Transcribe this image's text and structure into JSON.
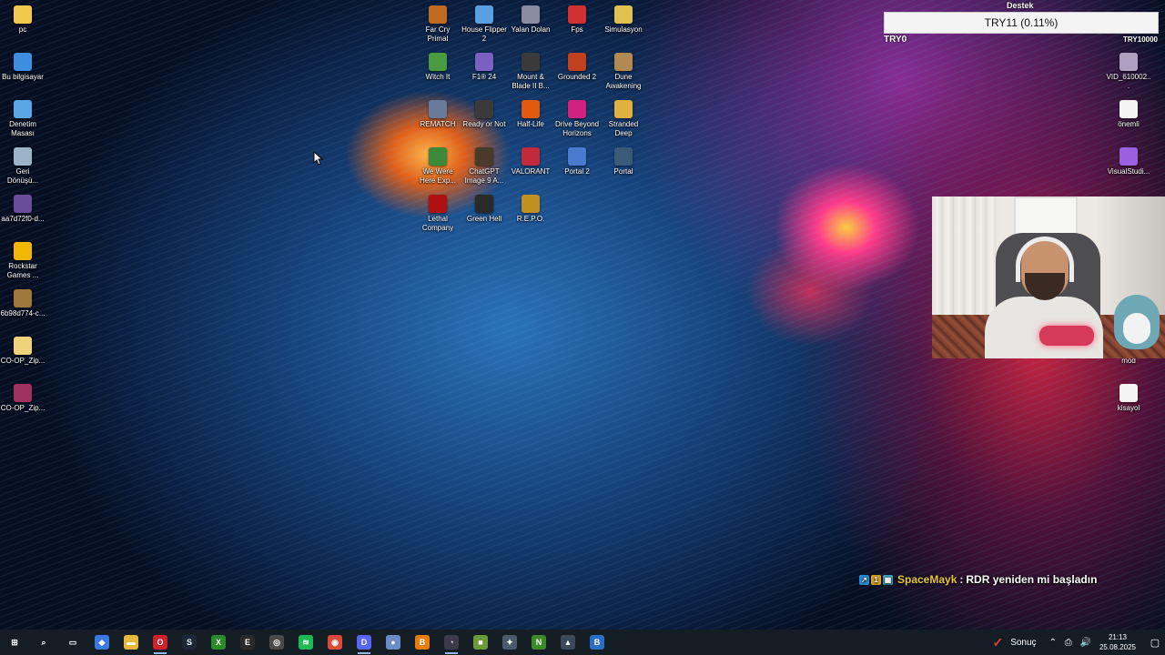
{
  "desktop": {
    "left_icons": [
      {
        "label": "pc",
        "icon": "folder-icon",
        "color": "#f2c94c"
      },
      {
        "label": "Bu bilgisayar",
        "icon": "computer-icon",
        "color": "#3d8ee0"
      },
      {
        "label": "Denetim Masası",
        "icon": "control-panel-icon",
        "color": "#5aa6e6"
      },
      {
        "label": "Geri Dönüşü...",
        "icon": "recycle-bin-icon",
        "color": "#9bb4c8"
      },
      {
        "label": "aa7d72f0-d...",
        "icon": "image-file-icon",
        "color": "#6b4c9a"
      },
      {
        "label": "Rockstar Games ...",
        "icon": "rockstar-icon",
        "color": "#f2b705"
      },
      {
        "label": "6b98d774-c...",
        "icon": "image-file-icon",
        "color": "#a0783c"
      },
      {
        "label": "CO-OP_Zip...",
        "icon": "zip-folder-icon",
        "color": "#f0d27a"
      },
      {
        "label": "CO-OP_Zip...",
        "icon": "winrar-icon",
        "color": "#a03060"
      }
    ],
    "game_icons": [
      [
        {
          "label": "Far Cry Primal",
          "icon": "far-cry-primal-icon",
          "color": "#c06a20"
        },
        {
          "label": "House Flipper 2",
          "icon": "house-flipper-icon",
          "color": "#5aa0e0"
        },
        {
          "label": "Yalan Dolan",
          "icon": "yalan-dolan-icon",
          "color": "#8a8aa0"
        },
        {
          "label": "Fps",
          "icon": "fps-icon",
          "color": "#d03030"
        },
        {
          "label": "Simulasyon",
          "icon": "folder-icon",
          "color": "#e0c050"
        }
      ],
      [
        {
          "label": "Witch It",
          "icon": "witch-it-icon",
          "color": "#4a9a40"
        },
        {
          "label": "F1® 24",
          "icon": "f1-icon",
          "color": "#7a60c0"
        },
        {
          "label": "Mount & Blade II B...",
          "icon": "mount-blade-icon",
          "color": "#3a3a3a"
        },
        {
          "label": "Grounded 2",
          "icon": "grounded-icon",
          "color": "#c04020"
        },
        {
          "label": "Dune Awakening",
          "icon": "dune-icon",
          "color": "#b08a50"
        }
      ],
      [
        {
          "label": "REMATCH",
          "icon": "rematch-icon",
          "color": "#6a7a9a"
        },
        {
          "label": "Ready or Not",
          "icon": "ready-or-not-icon",
          "color": "#3a3a3a"
        },
        {
          "label": "Half-Life",
          "icon": "half-life-icon",
          "color": "#e05a10"
        },
        {
          "label": "Drive Beyond Horizons",
          "icon": "drive-beyond-icon",
          "color": "#d02080"
        },
        {
          "label": "Stranded Deep",
          "icon": "stranded-deep-icon",
          "color": "#e0b040"
        }
      ],
      [
        {
          "label": "We Were Here Exp...",
          "icon": "we-were-here-icon",
          "color": "#3a8a3a"
        },
        {
          "label": "ChatGPT Image 9 A...",
          "icon": "image-file-icon",
          "color": "#4a3a2a"
        },
        {
          "label": "VALORANT",
          "icon": "valorant-icon",
          "color": "#c02a3a"
        },
        {
          "label": "Portal 2",
          "icon": "portal2-icon",
          "color": "#4a7ad0"
        },
        {
          "label": "Portal",
          "icon": "portal-icon",
          "color": "#3a5a7a"
        }
      ],
      [
        {
          "label": "Lethal Company",
          "icon": "lethal-company-icon",
          "color": "#b01010"
        },
        {
          "label": "Green Hell",
          "icon": "green-hell-icon",
          "color": "#2a2a2a"
        },
        {
          "label": "R.E.P.O.",
          "icon": "repo-icon",
          "color": "#c09020"
        }
      ]
    ],
    "right_icons": [
      {
        "label": "VID_610002...",
        "icon": "video-file-icon",
        "color": "#b0a0c0"
      },
      {
        "label": "önemli",
        "icon": "text-file-icon",
        "color": "#f4f4f4"
      },
      {
        "label": "VisualStudi...",
        "icon": "visual-studio-icon",
        "color": "#9a60e0"
      },
      {
        "label": "mod",
        "icon": "text-file-icon",
        "color": "#f4f4f4"
      },
      {
        "label": "kisayol",
        "icon": "text-file-icon",
        "color": "#f4f4f4"
      }
    ]
  },
  "donation": {
    "title": "Destek",
    "progress_text": "TRY11 (0.11%)",
    "progress_fraction": 0.0011,
    "min_label": "TRY0",
    "max_label": "TRY10000"
  },
  "chat": {
    "username": "SpaceMayk",
    "separator": ":",
    "message": "RDR yeniden mi başladın",
    "badge_1": "1",
    "username_color": "#e8c53a"
  },
  "taskbar": {
    "items": [
      {
        "name": "start-icon",
        "glyph": "⊞",
        "color": "#141c24",
        "active": false
      },
      {
        "name": "search-icon",
        "glyph": "⌕",
        "color": "#141c24",
        "active": false
      },
      {
        "name": "task-view-icon",
        "glyph": "▭",
        "color": "#141c24",
        "active": false
      },
      {
        "name": "copilot-icon",
        "glyph": "◆",
        "color": "#3a7ae0",
        "active": false
      },
      {
        "name": "file-explorer-icon",
        "glyph": "▬",
        "color": "#e6b83c",
        "active": false
      },
      {
        "name": "opera-icon",
        "glyph": "O",
        "color": "#d0202a",
        "active": true
      },
      {
        "name": "steam-icon",
        "glyph": "S",
        "color": "#1b2838",
        "active": false
      },
      {
        "name": "xbox-icon",
        "glyph": "X",
        "color": "#2a8a2a",
        "active": false
      },
      {
        "name": "epic-games-icon",
        "glyph": "E",
        "color": "#2a2a2a",
        "active": false
      },
      {
        "name": "obs-icon",
        "glyph": "◎",
        "color": "#4a4a4a",
        "active": false
      },
      {
        "name": "spotify-icon",
        "glyph": "≋",
        "color": "#1db954",
        "active": false
      },
      {
        "name": "chrome-icon",
        "glyph": "◉",
        "color": "#dd4b39",
        "active": false
      },
      {
        "name": "discord-icon",
        "glyph": "D",
        "color": "#5865f2",
        "active": true
      },
      {
        "name": "app-orb-icon",
        "glyph": "●",
        "color": "#6a8ac8",
        "active": false
      },
      {
        "name": "blender-icon",
        "glyph": "B",
        "color": "#e87d0d",
        "active": false
      },
      {
        "name": "speedometer-icon",
        "glyph": "◔",
        "color": "#3a3a4a",
        "active": true
      },
      {
        "name": "cube-app-icon",
        "glyph": "■",
        "color": "#6a9a3a",
        "active": false
      },
      {
        "name": "tool-app-icon",
        "glyph": "✦",
        "color": "#4a5a6a",
        "active": false
      },
      {
        "name": "nvidia-icon",
        "glyph": "N",
        "color": "#3a8a2a",
        "active": false
      },
      {
        "name": "dock-app-icon",
        "glyph": "▲",
        "color": "#3a4a5a",
        "active": false
      },
      {
        "name": "word-app-icon",
        "glyph": "B",
        "color": "#2b6cc4",
        "active": false
      }
    ],
    "widget_label": "Sonuç",
    "tray_icons": "⌃ ⎙ 🔊",
    "time": "21:13",
    "date": "25.08.2025",
    "notification_glyph": "▢"
  }
}
